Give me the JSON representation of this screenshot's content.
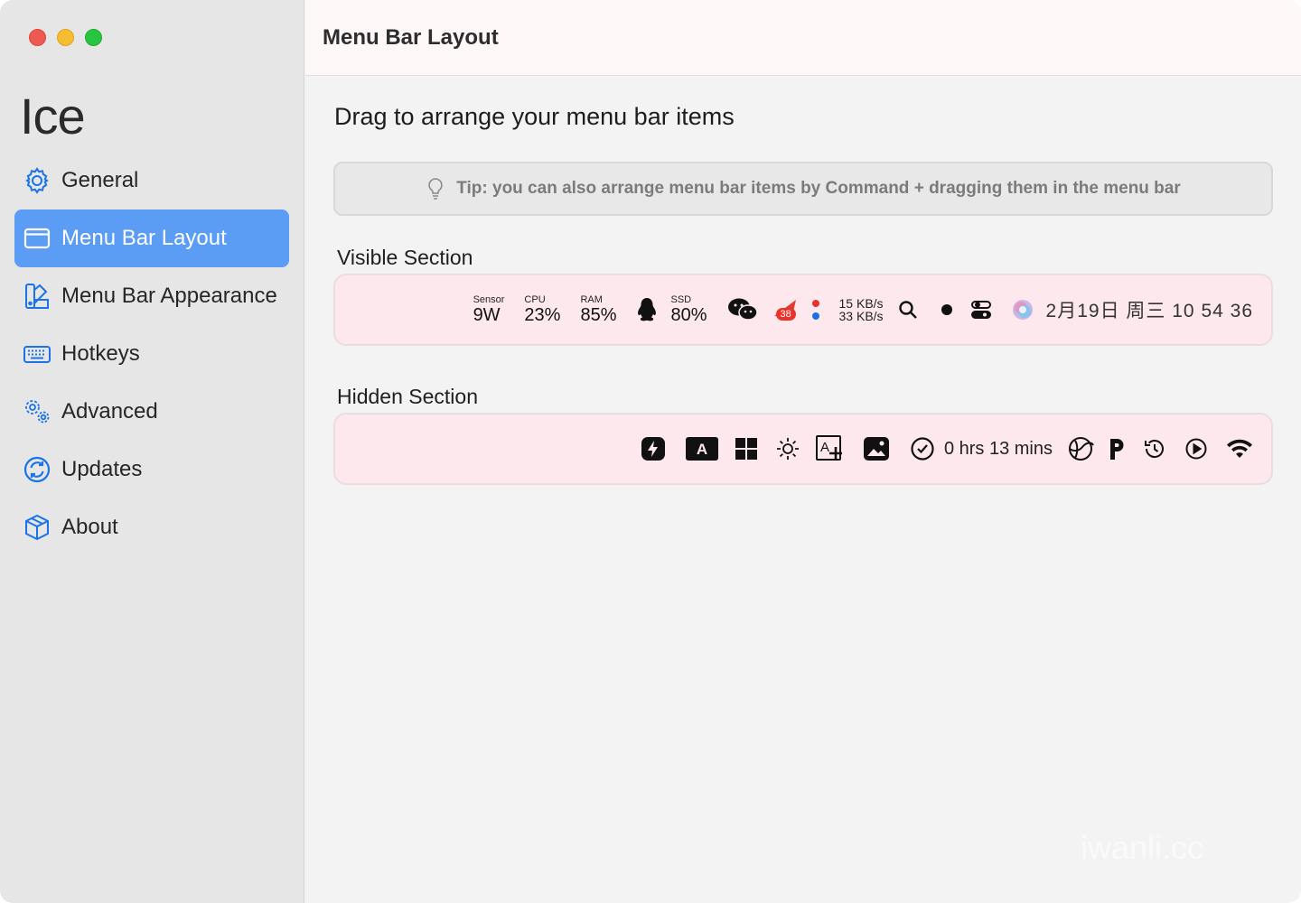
{
  "window": {
    "app_title": "Ice",
    "traffic_lights": [
      "close",
      "minimize",
      "zoom"
    ]
  },
  "sidebar": {
    "items": [
      {
        "label": "General",
        "icon": "gear-icon",
        "active": false
      },
      {
        "label": "Menu Bar Layout",
        "icon": "menubar-layout-icon",
        "active": true
      },
      {
        "label": "Menu Bar Appearance",
        "icon": "paint-swatch-icon",
        "active": false
      },
      {
        "label": "Hotkeys",
        "icon": "keyboard-icon",
        "active": false
      },
      {
        "label": "Advanced",
        "icon": "gears-icon",
        "active": false
      },
      {
        "label": "Updates",
        "icon": "refresh-icon",
        "active": false
      },
      {
        "label": "About",
        "icon": "cube-icon",
        "active": false
      }
    ]
  },
  "toolbar": {
    "title": "Menu Bar Layout"
  },
  "main": {
    "heading": "Drag to arrange your menu bar items",
    "tip": "Tip: you can also arrange menu bar items by Command + dragging them in the menu bar",
    "visible_section": {
      "label": "Visible Section",
      "stats": [
        {
          "label": "Sensor",
          "value": "9W"
        },
        {
          "label": "CPU",
          "value": "23%"
        },
        {
          "label": "RAM",
          "value": "85%"
        }
      ],
      "ssd": {
        "label": "SSD",
        "value": "80%"
      },
      "badge": "38",
      "net_up": "15 KB/s",
      "net_down": "33 KB/s",
      "clock": "2月19日 周三  10 54 36"
    },
    "hidden_section": {
      "label": "Hidden Section",
      "timer": "0 hrs 13 mins"
    }
  },
  "colors": {
    "accent": "#5b9cf5",
    "section_bg": "#fde9ed",
    "close": "#ee5a52",
    "minimize": "#f5bd2f",
    "zoom": "#29c440"
  },
  "watermark": "iwanli.cc"
}
